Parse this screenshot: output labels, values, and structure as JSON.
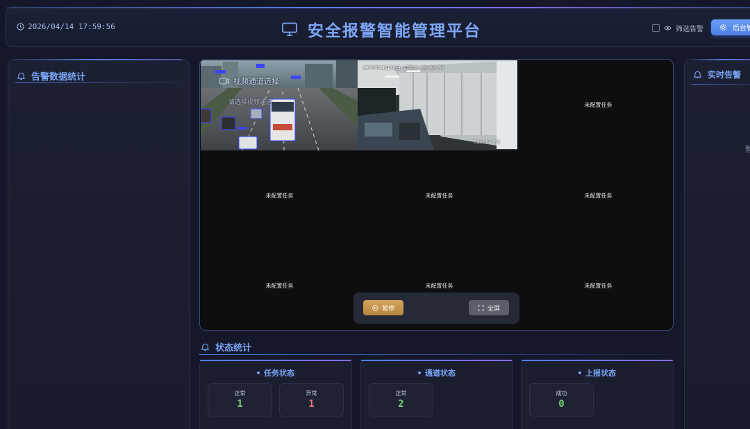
{
  "header": {
    "datetime": "2026/04/14 17:59:56",
    "title": "安全报警智能管理平台",
    "filter_label": "筛选告警",
    "admin_button": "后台管"
  },
  "left_panel": {
    "title": "告警数据统计"
  },
  "right_panel": {
    "title": "实时告警",
    "partial_text": "暫"
  },
  "video": {
    "channel_select_label": "视频通道选择",
    "channel_select_placeholder": "请选择视频通道",
    "camera2_timestamp": "1970年01月20日  星期二  23:20:57",
    "camera2_name": "Camera 01",
    "unconfigured_label": "未配置任务",
    "pause_label": "暂停",
    "fullscreen_label": "全屏"
  },
  "status_section": {
    "title": "状态统计",
    "cards": [
      {
        "title": "任务状态",
        "stats": [
          {
            "label": "正常",
            "value": "1",
            "tone": "ok"
          },
          {
            "label": "异常",
            "value": "1",
            "tone": "bad"
          }
        ]
      },
      {
        "title": "通道状态",
        "stats": [
          {
            "label": "正常",
            "value": "2",
            "tone": "ok"
          }
        ]
      },
      {
        "title": "上报状态",
        "stats": [
          {
            "label": "成功",
            "value": "0",
            "tone": "ok"
          }
        ]
      }
    ]
  },
  "colors": {
    "accent": "#7aa5f5",
    "ok": "#72d572",
    "bad": "#f07878",
    "pause": "#c99a50"
  }
}
